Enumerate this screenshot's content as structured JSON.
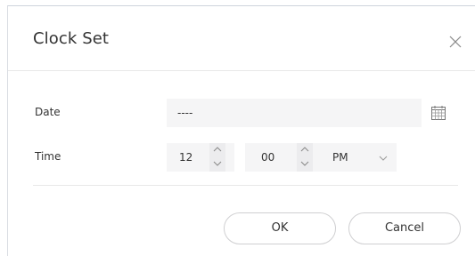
{
  "dialog": {
    "title": "Clock Set",
    "close_icon": "close-icon"
  },
  "form": {
    "date": {
      "label": "Date",
      "value": "----",
      "icon": "calendar-icon"
    },
    "time": {
      "label": "Time",
      "hour": "12",
      "minute": "00",
      "period": "PM"
    }
  },
  "buttons": {
    "ok_label": "OK",
    "cancel_label": "Cancel"
  },
  "colors": {
    "field_background": "#f5f5f6",
    "divider": "#e8e8e8",
    "text": "#333333"
  }
}
